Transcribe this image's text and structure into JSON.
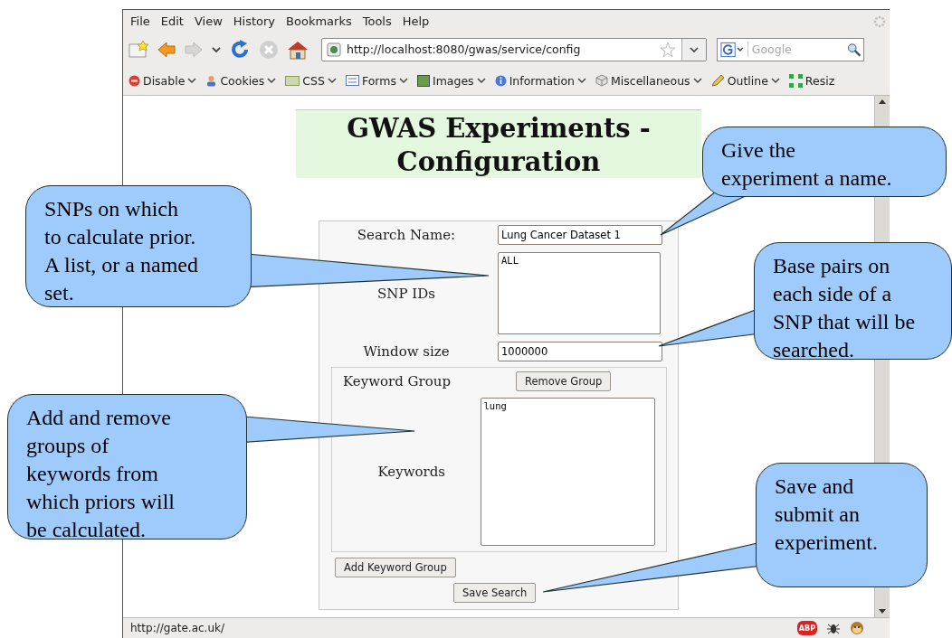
{
  "menu": [
    "File",
    "Edit",
    "View",
    "History",
    "Bookmarks",
    "Tools",
    "Help"
  ],
  "address": "http://localhost:8080/gwas/service/config",
  "search": {
    "placeholder": "Google"
  },
  "toolbar": [
    {
      "label": "Disable",
      "kind": "disable"
    },
    {
      "label": "Cookies",
      "kind": "cookies"
    },
    {
      "label": "CSS",
      "kind": "css"
    },
    {
      "label": "Forms",
      "kind": "forms"
    },
    {
      "label": "Images",
      "kind": "images"
    },
    {
      "label": "Information",
      "kind": "info"
    },
    {
      "label": "Miscellaneous",
      "kind": "misc"
    },
    {
      "label": "Outline",
      "kind": "outline"
    },
    {
      "label": "Resiz",
      "kind": "resize"
    }
  ],
  "page_title": "GWAS Experiments - Configuration",
  "form": {
    "search_name_label": "Search Name:",
    "search_name": "Lung Cancer Dataset 1",
    "snp_label": "SNP IDs",
    "snp_ids": "ALL",
    "window_label": "Window size",
    "window_size": "1000000",
    "keyword_group": {
      "title": "Keyword Group",
      "remove_button": "Remove Group",
      "keywords_label": "Keywords",
      "keywords": "lung"
    },
    "add_button": "Add Keyword Group",
    "save_button": "Save Search"
  },
  "status_bar": {
    "text": "http://gate.ac.uk/",
    "abp_label": "ABP"
  },
  "callouts": [
    "Give the\nexperiment a name.",
    "SNPs on which\nto calculate prior.\nA list, or a named\nset.",
    "Base pairs on\neach side of a\nSNP that will be\nsearched.",
    "Add and remove\ngroups of\nkeywords from\nwhich priors will\nbe calculated.",
    "Save and\nsubmit an\nexperiment."
  ]
}
